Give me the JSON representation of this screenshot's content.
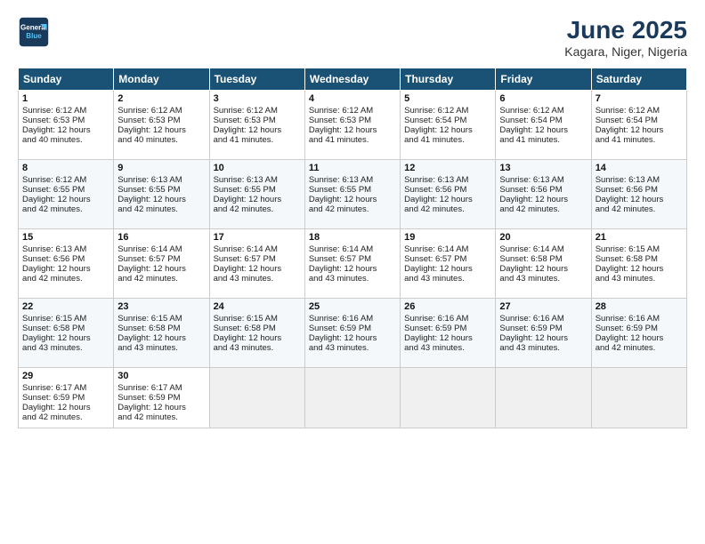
{
  "header": {
    "logo_line1": "General",
    "logo_line2": "Blue",
    "month": "June 2025",
    "location": "Kagara, Niger, Nigeria"
  },
  "days_of_week": [
    "Sunday",
    "Monday",
    "Tuesday",
    "Wednesday",
    "Thursday",
    "Friday",
    "Saturday"
  ],
  "weeks": [
    [
      {
        "day": "1",
        "lines": [
          "Sunrise: 6:12 AM",
          "Sunset: 6:53 PM",
          "Daylight: 12 hours",
          "and 40 minutes."
        ]
      },
      {
        "day": "2",
        "lines": [
          "Sunrise: 6:12 AM",
          "Sunset: 6:53 PM",
          "Daylight: 12 hours",
          "and 40 minutes."
        ]
      },
      {
        "day": "3",
        "lines": [
          "Sunrise: 6:12 AM",
          "Sunset: 6:53 PM",
          "Daylight: 12 hours",
          "and 41 minutes."
        ]
      },
      {
        "day": "4",
        "lines": [
          "Sunrise: 6:12 AM",
          "Sunset: 6:53 PM",
          "Daylight: 12 hours",
          "and 41 minutes."
        ]
      },
      {
        "day": "5",
        "lines": [
          "Sunrise: 6:12 AM",
          "Sunset: 6:54 PM",
          "Daylight: 12 hours",
          "and 41 minutes."
        ]
      },
      {
        "day": "6",
        "lines": [
          "Sunrise: 6:12 AM",
          "Sunset: 6:54 PM",
          "Daylight: 12 hours",
          "and 41 minutes."
        ]
      },
      {
        "day": "7",
        "lines": [
          "Sunrise: 6:12 AM",
          "Sunset: 6:54 PM",
          "Daylight: 12 hours",
          "and 41 minutes."
        ]
      }
    ],
    [
      {
        "day": "8",
        "lines": [
          "Sunrise: 6:12 AM",
          "Sunset: 6:55 PM",
          "Daylight: 12 hours",
          "and 42 minutes."
        ]
      },
      {
        "day": "9",
        "lines": [
          "Sunrise: 6:13 AM",
          "Sunset: 6:55 PM",
          "Daylight: 12 hours",
          "and 42 minutes."
        ]
      },
      {
        "day": "10",
        "lines": [
          "Sunrise: 6:13 AM",
          "Sunset: 6:55 PM",
          "Daylight: 12 hours",
          "and 42 minutes."
        ]
      },
      {
        "day": "11",
        "lines": [
          "Sunrise: 6:13 AM",
          "Sunset: 6:55 PM",
          "Daylight: 12 hours",
          "and 42 minutes."
        ]
      },
      {
        "day": "12",
        "lines": [
          "Sunrise: 6:13 AM",
          "Sunset: 6:56 PM",
          "Daylight: 12 hours",
          "and 42 minutes."
        ]
      },
      {
        "day": "13",
        "lines": [
          "Sunrise: 6:13 AM",
          "Sunset: 6:56 PM",
          "Daylight: 12 hours",
          "and 42 minutes."
        ]
      },
      {
        "day": "14",
        "lines": [
          "Sunrise: 6:13 AM",
          "Sunset: 6:56 PM",
          "Daylight: 12 hours",
          "and 42 minutes."
        ]
      }
    ],
    [
      {
        "day": "15",
        "lines": [
          "Sunrise: 6:13 AM",
          "Sunset: 6:56 PM",
          "Daylight: 12 hours",
          "and 42 minutes."
        ]
      },
      {
        "day": "16",
        "lines": [
          "Sunrise: 6:14 AM",
          "Sunset: 6:57 PM",
          "Daylight: 12 hours",
          "and 42 minutes."
        ]
      },
      {
        "day": "17",
        "lines": [
          "Sunrise: 6:14 AM",
          "Sunset: 6:57 PM",
          "Daylight: 12 hours",
          "and 43 minutes."
        ]
      },
      {
        "day": "18",
        "lines": [
          "Sunrise: 6:14 AM",
          "Sunset: 6:57 PM",
          "Daylight: 12 hours",
          "and 43 minutes."
        ]
      },
      {
        "day": "19",
        "lines": [
          "Sunrise: 6:14 AM",
          "Sunset: 6:57 PM",
          "Daylight: 12 hours",
          "and 43 minutes."
        ]
      },
      {
        "day": "20",
        "lines": [
          "Sunrise: 6:14 AM",
          "Sunset: 6:58 PM",
          "Daylight: 12 hours",
          "and 43 minutes."
        ]
      },
      {
        "day": "21",
        "lines": [
          "Sunrise: 6:15 AM",
          "Sunset: 6:58 PM",
          "Daylight: 12 hours",
          "and 43 minutes."
        ]
      }
    ],
    [
      {
        "day": "22",
        "lines": [
          "Sunrise: 6:15 AM",
          "Sunset: 6:58 PM",
          "Daylight: 12 hours",
          "and 43 minutes."
        ]
      },
      {
        "day": "23",
        "lines": [
          "Sunrise: 6:15 AM",
          "Sunset: 6:58 PM",
          "Daylight: 12 hours",
          "and 43 minutes."
        ]
      },
      {
        "day": "24",
        "lines": [
          "Sunrise: 6:15 AM",
          "Sunset: 6:58 PM",
          "Daylight: 12 hours",
          "and 43 minutes."
        ]
      },
      {
        "day": "25",
        "lines": [
          "Sunrise: 6:16 AM",
          "Sunset: 6:59 PM",
          "Daylight: 12 hours",
          "and 43 minutes."
        ]
      },
      {
        "day": "26",
        "lines": [
          "Sunrise: 6:16 AM",
          "Sunset: 6:59 PM",
          "Daylight: 12 hours",
          "and 43 minutes."
        ]
      },
      {
        "day": "27",
        "lines": [
          "Sunrise: 6:16 AM",
          "Sunset: 6:59 PM",
          "Daylight: 12 hours",
          "and 43 minutes."
        ]
      },
      {
        "day": "28",
        "lines": [
          "Sunrise: 6:16 AM",
          "Sunset: 6:59 PM",
          "Daylight: 12 hours",
          "and 42 minutes."
        ]
      }
    ],
    [
      {
        "day": "29",
        "lines": [
          "Sunrise: 6:17 AM",
          "Sunset: 6:59 PM",
          "Daylight: 12 hours",
          "and 42 minutes."
        ]
      },
      {
        "day": "30",
        "lines": [
          "Sunrise: 6:17 AM",
          "Sunset: 6:59 PM",
          "Daylight: 12 hours",
          "and 42 minutes."
        ]
      },
      {
        "day": "",
        "lines": []
      },
      {
        "day": "",
        "lines": []
      },
      {
        "day": "",
        "lines": []
      },
      {
        "day": "",
        "lines": []
      },
      {
        "day": "",
        "lines": []
      }
    ]
  ]
}
